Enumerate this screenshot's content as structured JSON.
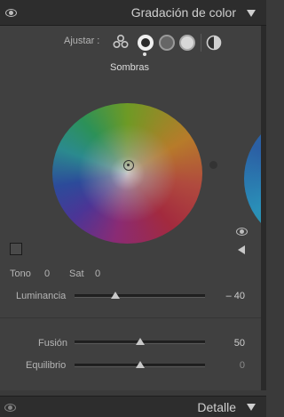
{
  "header": {
    "title": "Gradación de color"
  },
  "adjust": {
    "label": "Ajustar :"
  },
  "selected_region": "Sombras",
  "tone": {
    "label": "Tono",
    "value": "0"
  },
  "sat": {
    "label": "Sat",
    "value": "0"
  },
  "luminance": {
    "label": "Luminancia",
    "value": "– 40",
    "level": -40
  },
  "blending": {
    "label": "Fusión",
    "value": "50",
    "level": 50
  },
  "balance": {
    "label": "Equilibrio",
    "value": "0",
    "level": 0
  },
  "footer": {
    "title": "Detalle"
  }
}
